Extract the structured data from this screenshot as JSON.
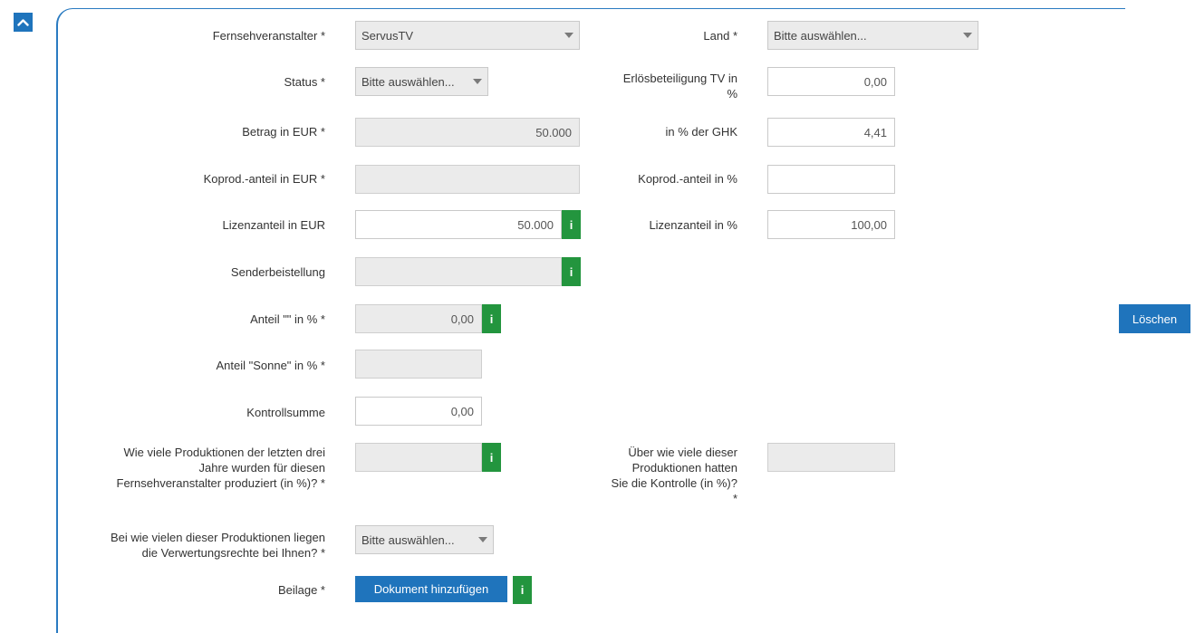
{
  "colors": {
    "accent": "#1f74bc",
    "info_green": "#23953e",
    "readonly_bg": "#ebebeb"
  },
  "icons": {
    "collapse": "chevron-up-icon",
    "info": "info-icon"
  },
  "info_symbol": "i",
  "delete_button": "Löschen",
  "form": {
    "broadcaster": {
      "label": "Fernsehveranstalter *",
      "value": "ServusTV"
    },
    "country": {
      "label": "Land *",
      "value": "Bitte auswählen..."
    },
    "status": {
      "label": "Status *",
      "value": "Bitte auswählen..."
    },
    "revenue_share_tv": {
      "label_line1": "Erlösbeteiligung TV in",
      "label_line2": "%",
      "value": "0,00"
    },
    "amount_eur": {
      "label": "Betrag in EUR *",
      "value": "50.000"
    },
    "pct_ghk": {
      "label": "in % der GHK",
      "value": "4,41"
    },
    "coprod_eur": {
      "label": "Koprod.-anteil in EUR *",
      "value": ""
    },
    "coprod_pct": {
      "label": "Koprod.-anteil in %",
      "value": ""
    },
    "license_eur": {
      "label": "Lizenzanteil in EUR",
      "value": "50.000"
    },
    "license_pct": {
      "label": "Lizenzanteil in %",
      "value": "100,00"
    },
    "sender_provision": {
      "label": "Senderbeistellung",
      "value": ""
    },
    "share_empty": {
      "label": "Anteil \"\" in % *",
      "value": "0,00"
    },
    "share_sonne": {
      "label": "Anteil \"Sonne\" in % *",
      "value": ""
    },
    "checksum": {
      "label": "Kontrollsumme",
      "value": "0,00"
    },
    "productions_pct": {
      "label_line1": "Wie viele Produktionen der letzten drei",
      "label_line2": "Jahre wurden für diesen",
      "label_line3": "Fernsehveranstalter produziert (in %)? *",
      "value": ""
    },
    "control_pct": {
      "label_line1": "Über wie viele dieser",
      "label_line2": "Produktionen hatten",
      "label_line3": "Sie die Kontrolle (in %)?",
      "label_line4": "*",
      "value": ""
    },
    "rights": {
      "label_line1": "Bei wie vielen dieser Produktionen liegen",
      "label_line2": "die Verwertungsrechte bei Ihnen? *",
      "value": "Bitte auswählen..."
    },
    "attachment": {
      "label": "Beilage *",
      "button": "Dokument hinzufügen"
    }
  }
}
